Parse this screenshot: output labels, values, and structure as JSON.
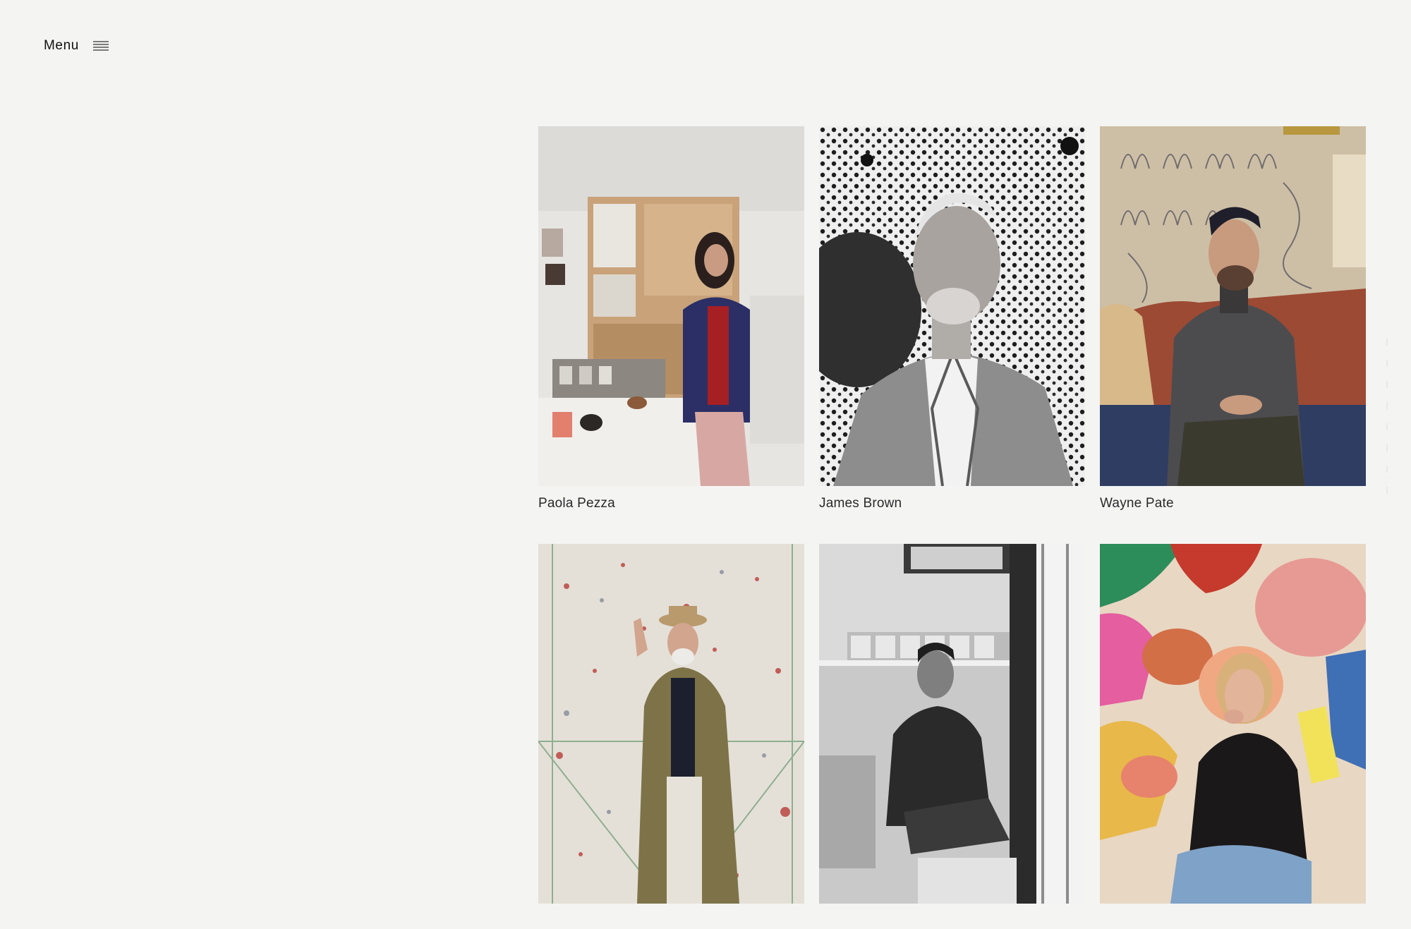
{
  "nav": {
    "menu_label": "Menu",
    "menu_icon": "hamburger-icon"
  },
  "gallery": {
    "artists": [
      {
        "name": "Paola Pezza",
        "photo": "studio-portrait",
        "palette": "color"
      },
      {
        "name": "James Brown",
        "photo": "dotted-background-portrait",
        "palette": "grayscale"
      },
      {
        "name": "Wayne Pate",
        "photo": "sofa-portrait",
        "palette": "color"
      },
      {
        "name": "",
        "photo": "fur-coat-portrait",
        "palette": "color"
      },
      {
        "name": "",
        "photo": "window-portrait",
        "palette": "grayscale"
      },
      {
        "name": "",
        "photo": "colorful-painting-portrait",
        "palette": "color"
      }
    ]
  },
  "colors": {
    "background": "#f4f4f3",
    "text": "#1a1a1a"
  }
}
